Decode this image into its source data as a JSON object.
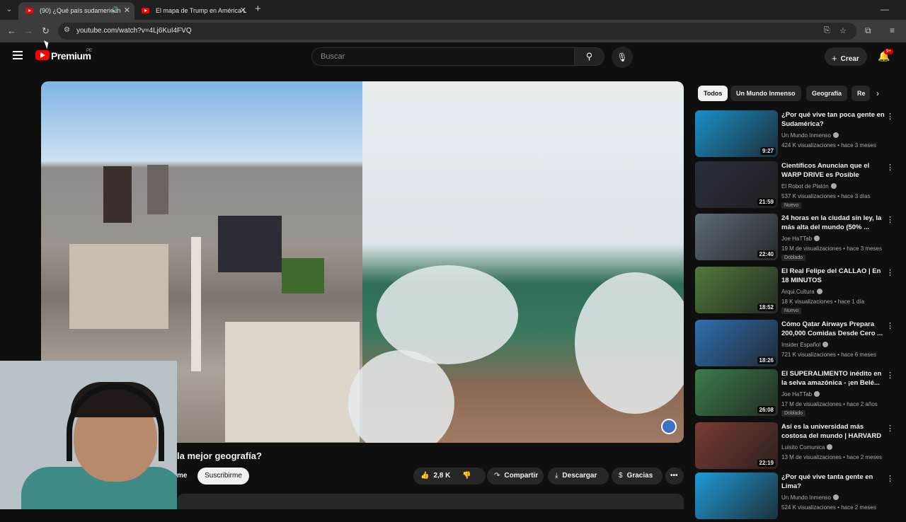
{
  "browser": {
    "tabs": [
      {
        "title": "(90) ¿Qué país sudamerican",
        "active": true,
        "audio": true
      },
      {
        "title": "El mapa de Trump en América L",
        "active": false
      }
    ],
    "new_tab": "+",
    "url": "youtube.com/watch?v=4Lj6KuI4FVQ"
  },
  "header": {
    "logo_text": "Premium",
    "logo_country": "PE",
    "search_placeholder": "Buscar",
    "create_label": "Crear",
    "notifications_badge": "9+"
  },
  "video": {
    "title": "la mejor geografía?",
    "channel_fragment": "me",
    "subscribe_label": "Suscribirme",
    "likes": "2,8 K",
    "share_label": "Compartir",
    "download_label": "Descargar",
    "thanks_label": "Gracias"
  },
  "chips": [
    "Todos",
    "Un Mundo Inmenso",
    "Geografía",
    "Re"
  ],
  "recommendations": [
    {
      "title": "¿Por qué vive tan poca gente en Sudamérica?",
      "channel": "Un Mundo Inmenso",
      "verified": true,
      "views": "424 K visualizaciones",
      "age": "hace 3 meses",
      "duration": "9:27",
      "tag": "",
      "thumb_color": "#1a8fc9"
    },
    {
      "title": "Científicos Anuncian que el WARP DRIVE es Posible",
      "channel": "El Robot de Platón",
      "verified": true,
      "views": "537 K visualizaciones",
      "age": "hace 3 días",
      "duration": "21:59",
      "tag": "Nuevo",
      "thumb_color": "#2a2f3a"
    },
    {
      "title": "24 horas en la ciudad sin ley, la más alta del mundo (50% ...",
      "channel": "Joe HaTTab",
      "verified": true,
      "views": "19 M de visualizaciones",
      "age": "hace 3 meses",
      "duration": "22:40",
      "tag": "Doblado",
      "thumb_color": "#5c6b74"
    },
    {
      "title": "El Real Felipe del CALLAO | En 18 MINUTOS",
      "channel": "Arqui.Cultura",
      "verified": true,
      "views": "18 K visualizaciones",
      "age": "hace 1 día",
      "duration": "18:52",
      "tag": "Nuevo",
      "thumb_color": "#4f7a3a"
    },
    {
      "title": "Cómo Qatar Airways Prepara 200,000 Comidas Desde Cero ...",
      "channel": "Insider Español",
      "verified": true,
      "views": "721 K visualizaciones",
      "age": "hace 6 meses",
      "duration": "18:26",
      "tag": "",
      "thumb_color": "#2f6fb0"
    },
    {
      "title": "El SUPERALIMENTO inédito en la selva amazónica - ¡en Belé...",
      "channel": "Joe HaTTab",
      "verified": true,
      "views": "17 M de visualizaciones",
      "age": "hace 2 años",
      "duration": "26:08",
      "tag": "Doblado",
      "thumb_color": "#3b7d4a"
    },
    {
      "title": "Así es la universidad más costosa del mundo | HARVARD",
      "channel": "Luisito Comunica",
      "verified": true,
      "views": "13 M de visualizaciones",
      "age": "hace 2 meses",
      "duration": "22:19",
      "tag": "",
      "thumb_color": "#7a3b32"
    },
    {
      "title": "¿Por qué vive tanta gente en Lima?",
      "channel": "Un Mundo Inmenso",
      "verified": true,
      "views": "524 K visualizaciones",
      "age": "hace 2 meses",
      "duration": "",
      "tag": "",
      "thumb_color": "#1e9ad6"
    }
  ]
}
